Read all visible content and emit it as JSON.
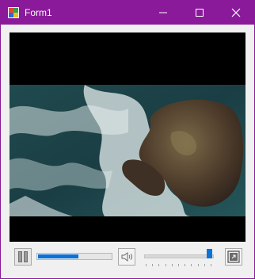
{
  "window": {
    "title": "Form1",
    "accent_color": "#8a1a9a",
    "icons": [
      "app-icon",
      "minimize-icon",
      "maximize-icon",
      "close-icon"
    ]
  },
  "player": {
    "state": "playing",
    "progress_fraction": 0.55,
    "volume_fraction": 0.95,
    "volume_ticks": 11,
    "icons": [
      "pause-icon",
      "speaker-icon",
      "fullscreen-icon"
    ],
    "accent_color": "#0a73d8"
  }
}
